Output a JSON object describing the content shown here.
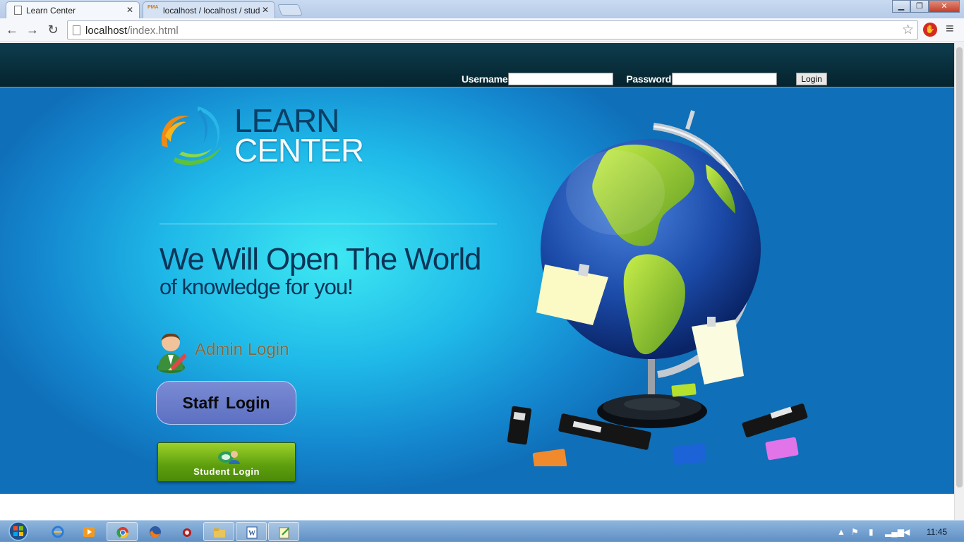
{
  "browser": {
    "tabs": [
      {
        "label": "Learn Center",
        "active": true
      },
      {
        "label": "localhost / localhost / stud",
        "icon_text": "PMA",
        "active": false
      }
    ],
    "url_host": "localhost",
    "url_path": "/index.html",
    "window_controls": {
      "minimize": "▁",
      "maximize": "❐",
      "close": "✕"
    }
  },
  "header": {
    "username_label": "Username",
    "password_label": "Password",
    "username_value": "",
    "password_value": "",
    "login_button": "Login"
  },
  "hero": {
    "logo_line1": "LEARN",
    "logo_line2": "CENTER",
    "headline": "We Will Open The World",
    "subline": "of knowledge for you!",
    "admin_login": "Admin Login",
    "staff_login": "Staff  Login",
    "student_login": "Student Login"
  },
  "taskbar": {
    "clock": "11:45",
    "apps": [
      "start-orb",
      "internet-explorer",
      "media-player",
      "chrome",
      "firefox",
      "app-icon",
      "explorer",
      "word",
      "notepad"
    ]
  },
  "colors": {
    "topbar": "#05232e",
    "hero_light": "#3ee8f2",
    "hero_dark": "#0f6fb8",
    "headline": "#0b3558",
    "staff_button": "#6a7ccb",
    "student_button": "#5d9e0e"
  }
}
